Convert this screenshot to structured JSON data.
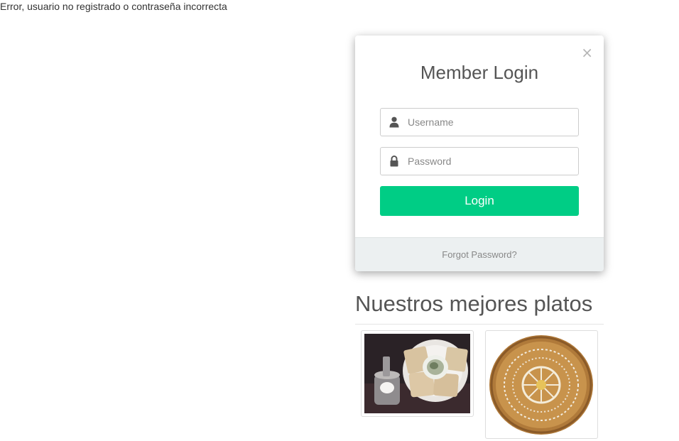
{
  "page": {
    "error_message": "Error, usuario no registrado o contraseña incorrecta"
  },
  "login_modal": {
    "close_label": "×",
    "title": "Member Login",
    "username_placeholder": "Username",
    "password_placeholder": "Password",
    "login_button": "Login",
    "forgot_password": "Forgot Password?",
    "accent_color": "#00cd85"
  },
  "dishes_section": {
    "title": "Nuestros mejores platos",
    "images": [
      {
        "name": "coffee-and-toast-photo"
      },
      {
        "name": "bread-loaf-photo"
      }
    ]
  },
  "icons": {
    "username": "user-icon",
    "password": "lock-icon"
  }
}
